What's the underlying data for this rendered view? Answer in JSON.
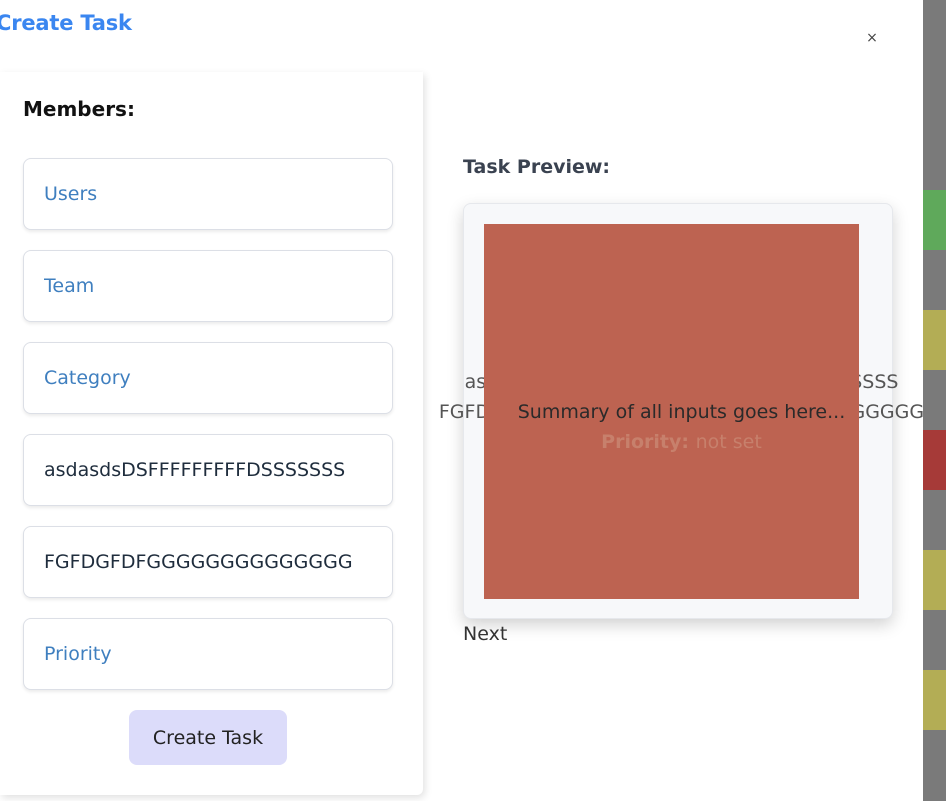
{
  "modal": {
    "title": "Create Task",
    "close_symbol": "×"
  },
  "form": {
    "members_heading": "Members:",
    "fields": {
      "users": {
        "placeholder": "Users",
        "value": ""
      },
      "team": {
        "placeholder": "Team",
        "value": ""
      },
      "category": {
        "placeholder": "Category",
        "value": ""
      },
      "title": {
        "placeholder": "",
        "value": "asdasdsDSFFFFFFFFFDSSSSSSS"
      },
      "description": {
        "placeholder": "",
        "value": "FGFDGFDFGGGGGGGGGGGGGG"
      },
      "priority": {
        "placeholder": "Priority",
        "value": ""
      }
    },
    "submit_label": "Create Task"
  },
  "preview": {
    "heading": "Task Preview:",
    "title_text": "asdasdsDSFFFFFFFFFDSSSSSSSSSSSSSSSSSS",
    "description_text": "FGFDGFDFGGGGGGGGGGGGGGGGGGGGGGGGGG",
    "priority_label": "Priority:",
    "priority_value": "not set",
    "summary_text": "Summary of all inputs goes here...",
    "next_label": "Next"
  },
  "colors": {
    "accent": "#3a86f0",
    "placeholder": "#3f7fbf",
    "overlay": "#bd6351",
    "create_button_bg": "#dcdcfa",
    "strip_blocks": [
      "#5fa95b",
      "#b3ad55",
      "#a63a38",
      "#b3ad55",
      "#b3ad55"
    ]
  }
}
